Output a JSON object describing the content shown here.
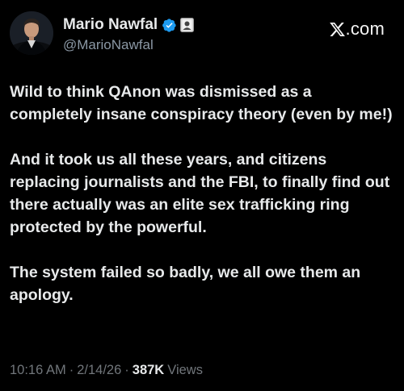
{
  "author": {
    "display_name": "Mario Nawfal",
    "handle": "@MarioNawfal",
    "avatar_icon": "profile-photo",
    "verified_icon": "verified-badge-icon",
    "affiliate_icon": "affiliate-badge-icon",
    "verified_color": "#1d9bf0"
  },
  "brand": {
    "logo_icon": "x-logo-icon",
    "domain": ".com"
  },
  "post": {
    "paragraphs": [
      "Wild to think QAnon was dismissed as a completely insane conspiracy theory (even by me!)",
      "And it took us all these years, and citizens replacing journalists and the FBI, to finally find out there actually was an elite sex trafficking ring protected by the powerful.",
      "The system failed so badly, we all owe them an apology."
    ]
  },
  "meta": {
    "time": "10:16 AM",
    "separator": "·",
    "date": "2/14/26",
    "views_count": "387K",
    "views_label": "Views"
  },
  "colors": {
    "background": "#000000",
    "primary_text": "#e7e9ea",
    "secondary_text": "#71767b",
    "handle_text": "#8b98a5"
  }
}
